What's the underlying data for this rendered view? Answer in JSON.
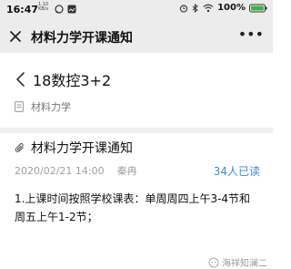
{
  "status_bar": {
    "time": "16:47",
    "network_speed": "1.10",
    "network_unit": "KB/s",
    "battery": "100%",
    "icons": [
      "whatsapp-icon",
      "gallery-icon",
      "alarm-icon",
      "bluetooth-icon",
      "wifi-icon",
      "battery-icon"
    ]
  },
  "title_bar": {
    "title": "材料力学开课通知",
    "close_icon": "close-icon",
    "more_icon": "more-icon"
  },
  "header": {
    "group_name": "18数控3+2",
    "course": "材料力学"
  },
  "post": {
    "title": "材料力学开课通知",
    "datetime": "2020/02/21 14:00",
    "author": "秦冉",
    "read_count": "34人已读",
    "body": "1.上课时间按照学校课表：单周周四上午3-4节和周五上午1-2节；"
  },
  "watermark": {
    "text": "海祥知澜二"
  },
  "colors": {
    "accent": "#3f8ad9",
    "bar_bg": "#ececec",
    "divider": "#f0f0f0"
  }
}
